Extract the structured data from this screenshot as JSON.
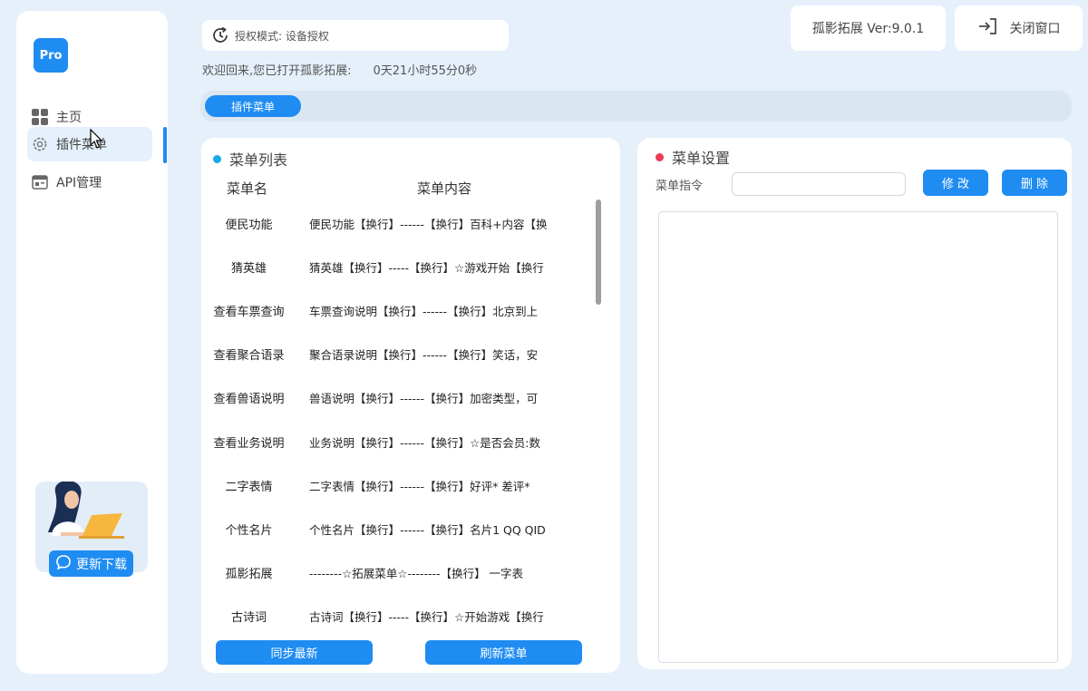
{
  "sidebar": {
    "logo": "Pro",
    "items": [
      {
        "label": "主页",
        "icon": "grid-icon"
      },
      {
        "label": "插件菜单",
        "icon": "gear-icon"
      },
      {
        "label": "API管理",
        "icon": "api-icon"
      }
    ],
    "update_label": "更新下载"
  },
  "header": {
    "auth_mode": "授权模式: 设备授权",
    "welcome": "欢迎回来,您已打开孤影拓展:",
    "uptime": "0天21小时55分0秒",
    "version": "孤影拓展 Ver:9.0.1",
    "close_label": "关闭窗口"
  },
  "tabs": [
    {
      "label": "插件菜单"
    }
  ],
  "menu_list": {
    "title": "菜单列表",
    "columns": [
      "菜单名",
      "菜单内容"
    ],
    "rows": [
      {
        "name": "便民功能",
        "content": "便民功能【换行】------【换行】百科+内容【换"
      },
      {
        "name": "猜英雄",
        "content": "猜英雄【换行】-----【换行】☆游戏开始【换行"
      },
      {
        "name": "查看车票查询",
        "content": "车票查询说明【换行】------【换行】北京到上"
      },
      {
        "name": "查看聚合语录",
        "content": "聚合语录说明【换行】------【换行】笑话，安"
      },
      {
        "name": "查看兽语说明",
        "content": "兽语说明【换行】------【换行】加密类型，可"
      },
      {
        "name": "查看业务说明",
        "content": "业务说明【换行】------【换行】☆是否会员:数"
      },
      {
        "name": "二字表情",
        "content": "二字表情【换行】------【换行】好评* 差评*"
      },
      {
        "name": "个性名片",
        "content": "个性名片【换行】------【换行】名片1 QQ QID"
      },
      {
        "name": "孤影拓展",
        "content": "--------☆拓展菜单☆--------【换行】 一字表"
      },
      {
        "name": "古诗词",
        "content": "古诗词【换行】-----【换行】☆开始游戏【换行"
      }
    ],
    "sync_label": "同步最新",
    "refresh_label": "刷新菜单"
  },
  "settings": {
    "title": "菜单设置",
    "command_label": "菜单指令",
    "command_value": "",
    "edit_label": "修 改",
    "delete_label": "删 除",
    "content_value": ""
  },
  "colors": {
    "accent": "#1f8cf2",
    "background": "#e6f0fb",
    "list_dot": "#16a9e8",
    "settings_dot": "#ee3a55"
  }
}
